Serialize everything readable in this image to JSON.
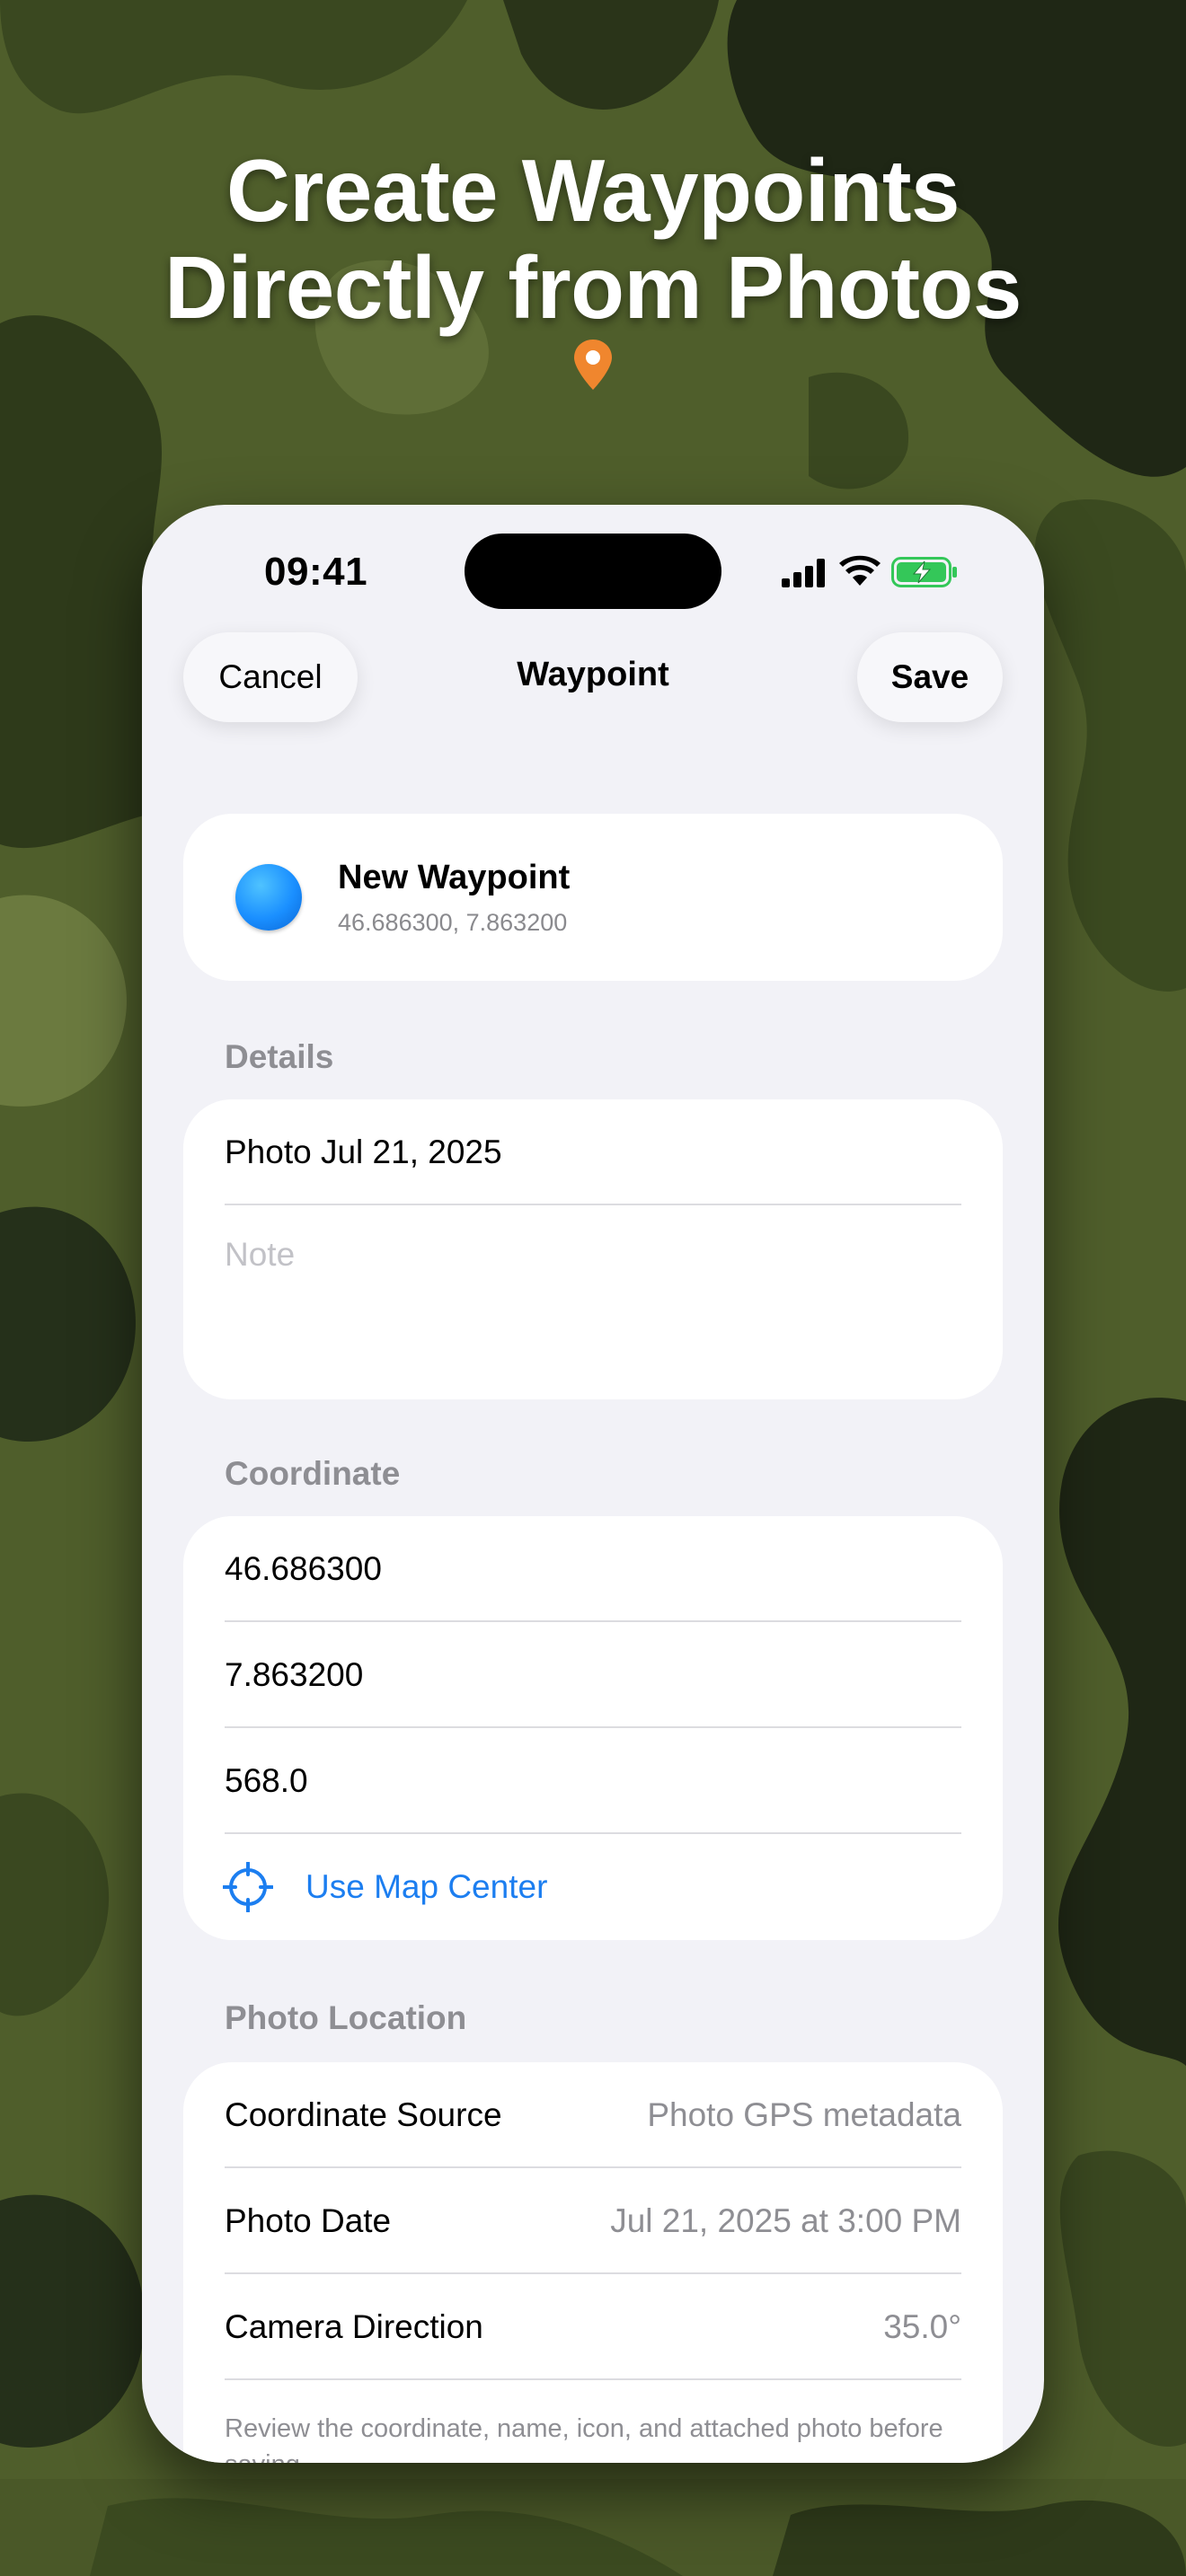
{
  "colors": {
    "camo_dark": "#1f2715",
    "camo_mid": "#3b4a20",
    "camo_light": "#5c6b34",
    "accent_blue": "#1c7ef0",
    "pin_orange": "#f0862e",
    "screen_bg": "#f2f2f7"
  },
  "headline": {
    "line1": "Create Waypoints",
    "line2": "Directly from Photos"
  },
  "status_bar": {
    "time": "09:41",
    "icons": [
      "cellular-signal-icon",
      "wifi-icon",
      "battery-charging-icon"
    ]
  },
  "nav": {
    "cancel_label": "Cancel",
    "title": "Waypoint",
    "save_label": "Save"
  },
  "waypoint": {
    "icon": "blue-dot-icon",
    "name": "New Waypoint",
    "coords": "46.686300, 7.863200"
  },
  "details": {
    "header": "Details",
    "title_value": "Photo Jul 21, 2025",
    "note_placeholder": "Note"
  },
  "coordinate": {
    "header": "Coordinate",
    "latitude": "46.686300",
    "longitude": "7.863200",
    "altitude": "568.0",
    "map_center_label": "Use Map Center",
    "map_center_icon": "crosshair-icon"
  },
  "photo_location": {
    "header": "Photo Location",
    "rows": [
      {
        "label": "Coordinate Source",
        "value": "Photo GPS metadata"
      },
      {
        "label": "Photo Date",
        "value": "Jul 21, 2025 at 3:00 PM"
      },
      {
        "label": "Camera Direction",
        "value": "35.0°"
      }
    ],
    "footnote": "Review the coordinate, name, icon, and attached photo before saving."
  }
}
